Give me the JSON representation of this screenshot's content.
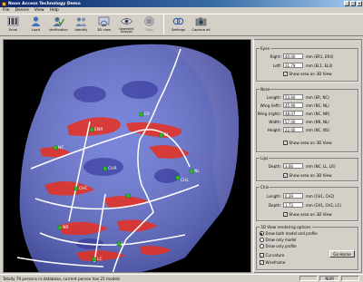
{
  "window": {
    "title": "Noon Access Technology Demo",
    "controls": [
      "_",
      "□",
      "×"
    ]
  },
  "menu": [
    "File",
    "Device",
    "View",
    "Help"
  ],
  "toolbar": [
    {
      "label": "Enrol",
      "icon": "barcode-icon"
    },
    {
      "label": "Load",
      "icon": "person-icon"
    },
    {
      "label": "Verification",
      "icon": "verify-icon"
    },
    {
      "label": "Identify",
      "icon": "identify-icon"
    },
    {
      "label": "3D view",
      "icon": "3d-view-icon"
    },
    {
      "label": "Geometric Analysis",
      "icon": "eye-icon"
    },
    {
      "label": "Stop",
      "icon": "stop-icon"
    },
    {
      "label": "Settings",
      "icon": "rings-icon"
    },
    {
      "label": "Capture all",
      "icon": "camera-icon"
    }
  ],
  "viewport": {
    "landmarks": [
      "EL",
      "ER",
      "ENR",
      "NC",
      "NL",
      "CHL",
      "CHR",
      "CHC",
      "NR",
      "LL",
      "LC"
    ]
  },
  "eyes": {
    "title": "Eyes",
    "right": {
      "label": "Right:",
      "value": "40.00",
      "unit": "mm (ER1, ER4)"
    },
    "left": {
      "label": "Left:",
      "value": "31.79",
      "unit": "mm (EL1, EL3)"
    },
    "show": "Show area on 3D View"
  },
  "nose": {
    "title": "Nose",
    "rows": [
      {
        "label": "Length:",
        "value": "53.60",
        "unit": "mm (ER, NC)"
      },
      {
        "label": "Wing (left):",
        "value": "45.90",
        "unit": "mm (NC, NL)"
      },
      {
        "label": "Wing (right):",
        "value": "48.07",
        "unit": "mm (NC, NR)"
      },
      {
        "label": "Width:",
        "value": "57.00",
        "unit": "mm (NR, NL)"
      },
      {
        "label": "Height:",
        "value": "22.60",
        "unit": "mm (NC, NS)"
      }
    ],
    "show": "Show area on 3D View"
  },
  "lips": {
    "title": "Lips",
    "depth": {
      "label": "Depth:",
      "value": "3.66",
      "unit": "mm (NC, LL, LR)"
    },
    "show": "Show area on 3D View"
  },
  "chin": {
    "title": "Chin",
    "length": {
      "label": "Length:",
      "value": "6.39",
      "unit": "mm (CH1, CH2)"
    },
    "depth": {
      "label": "Depth:",
      "value": "1.73",
      "unit": "mm (CH1, CH2, LC)"
    },
    "show": "Show area on 3D View"
  },
  "render": {
    "title": "3D View rendering options",
    "options": [
      {
        "label": "Draw both model and profile",
        "selected": true
      },
      {
        "label": "Draw only model",
        "selected": false
      },
      {
        "label": "Draw only profile",
        "selected": false
      }
    ],
    "curvature": "Curvature",
    "wireframe": "Wireframe",
    "go_home": "Go Home"
  },
  "status": {
    "message": "Totally 79 persons in database, current person has 21 models",
    "panes": [
      "",
      "NUM",
      ""
    ]
  },
  "colors": {
    "titlebar": "#0a246a",
    "face_blue": "#5a6ad8",
    "ridge_red": "#e83020",
    "landmark_green": "#30c030"
  }
}
